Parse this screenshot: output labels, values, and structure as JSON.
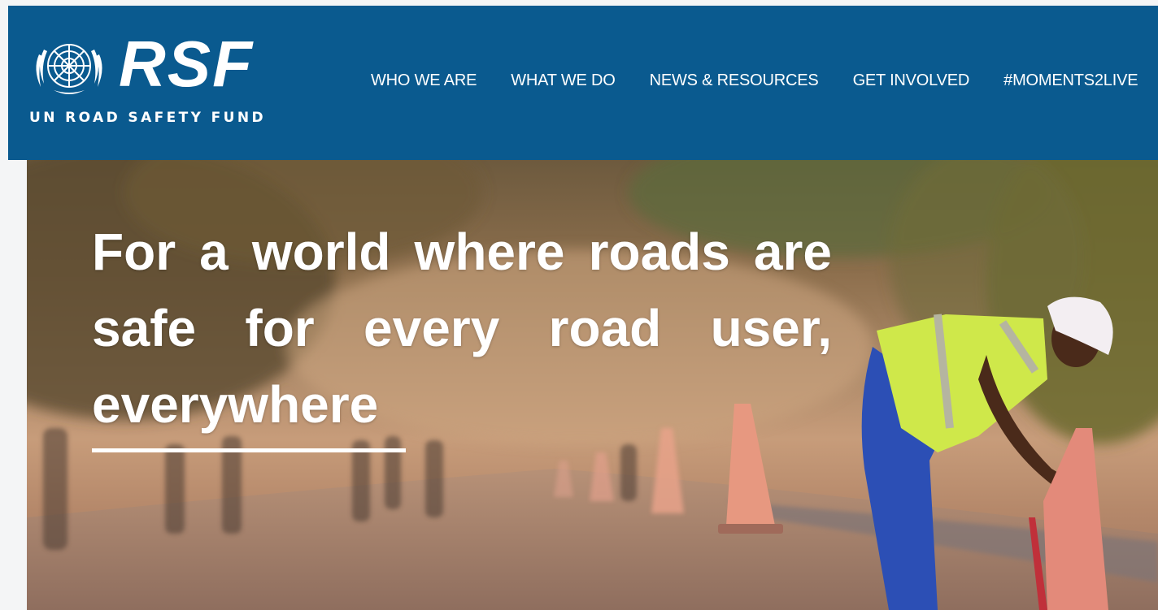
{
  "header": {
    "logo": {
      "wordmark": "RSF",
      "tagline": "UN ROAD SAFETY FUND",
      "emblem_icon": "un-emblem-icon"
    },
    "nav": [
      {
        "label": "WHO WE ARE"
      },
      {
        "label": "WHAT WE DO"
      },
      {
        "label": "NEWS & RESOURCES"
      },
      {
        "label": "GET INVOLVED"
      },
      {
        "label": "#MOMENTS2LIVE"
      }
    ],
    "background_color": "#0a5a8f"
  },
  "hero": {
    "headline": "For a world where roads are safe for every road user, everywhere",
    "image_subject": "road-worker-with-traffic-cones-photo"
  }
}
